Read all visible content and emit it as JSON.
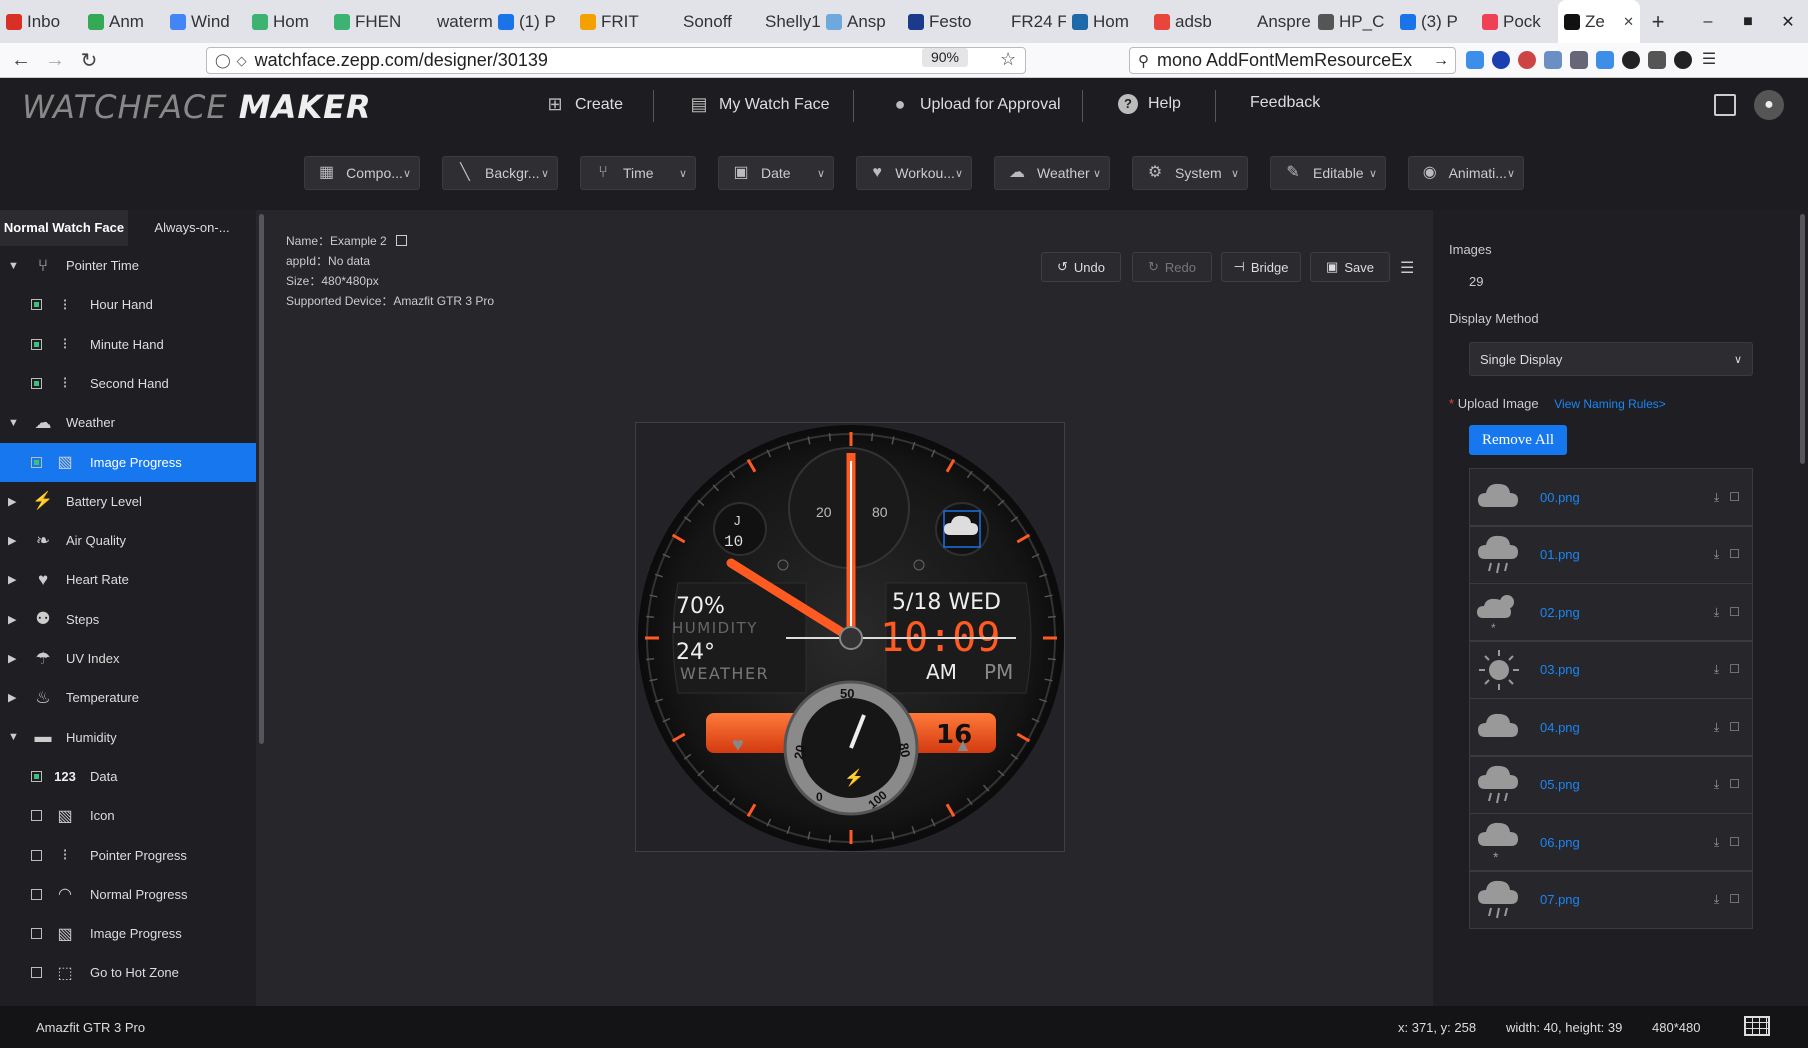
{
  "browser": {
    "tabs": [
      {
        "label": "Inbo",
        "color": "#d93025"
      },
      {
        "label": "Anm",
        "color": "#34a853"
      },
      {
        "label": "Wind",
        "color": "#4285f4"
      },
      {
        "label": "Hom",
        "color": "#3cb371"
      },
      {
        "label": "FHEN",
        "color": "#3cb371"
      },
      {
        "label": "waterm",
        "color": "#e1e3e8"
      },
      {
        "label": "(1) P",
        "color": "#1a73e8"
      },
      {
        "label": "FRIT",
        "color": "#f4a100"
      },
      {
        "label": "Sonoff",
        "color": "#e1e3e8"
      },
      {
        "label": "Shelly1",
        "color": "#e1e3e8"
      },
      {
        "label": "Ansp",
        "color": "#6fa8dc"
      },
      {
        "label": "Festo",
        "color": "#1a3a8a"
      },
      {
        "label": "FR24 F",
        "color": "#e1e3e8"
      },
      {
        "label": "Hom",
        "color": "#1e6aa8"
      },
      {
        "label": "adsb",
        "color": "#e8453c"
      },
      {
        "label": "Anspre",
        "color": "#e1e3e8"
      },
      {
        "label": "HP_C",
        "color": "#555555"
      },
      {
        "label": "(3) P",
        "color": "#1a73e8"
      },
      {
        "label": "Pock",
        "color": "#ef4056"
      },
      {
        "label": "Ze",
        "color": "#111111"
      }
    ],
    "new_tab": "+",
    "url": "watchface.zepp.com/designer/30139",
    "zoom": "90%",
    "search": "mono AddFontMemResourceEx"
  },
  "header": {
    "logo_light": "WATCHFACE",
    "logo_bold": "MAKER",
    "menu": [
      {
        "label": "Create",
        "icon": "plus-square-icon"
      },
      {
        "label": "My Watch Face",
        "icon": "folder-icon"
      },
      {
        "label": "Upload for Approval",
        "icon": "user-icon"
      },
      {
        "label": "Help",
        "icon": "help-icon"
      },
      {
        "label": "Feedback",
        "icon": ""
      }
    ],
    "components": [
      {
        "label": "Compo...",
        "icon": "grid-icon"
      },
      {
        "label": "Backgr...",
        "icon": "hatch-icon"
      },
      {
        "label": "Time",
        "icon": "hands-icon"
      },
      {
        "label": "Date",
        "icon": "calendar-icon"
      },
      {
        "label": "Workou...",
        "icon": "heart-icon"
      },
      {
        "label": "Weather",
        "icon": "cloud-sun-icon"
      },
      {
        "label": "System",
        "icon": "gear-icon"
      },
      {
        "label": "Editable",
        "icon": "edit-icon"
      },
      {
        "label": "Animati...",
        "icon": "animation-icon"
      }
    ]
  },
  "left": {
    "tabs": [
      "Normal Watch Face",
      "Always-on-..."
    ],
    "tree": [
      {
        "label": "Pointer Time",
        "type": "group",
        "expanded": true,
        "icon": "pointer-time-icon"
      },
      {
        "label": "Hour Hand",
        "type": "child",
        "checked": true,
        "icon": "hand-icon"
      },
      {
        "label": "Minute Hand",
        "type": "child",
        "checked": true,
        "icon": "hand-icon"
      },
      {
        "label": "Second Hand",
        "type": "child",
        "checked": true,
        "icon": "hand-icon"
      },
      {
        "label": "Weather",
        "type": "group",
        "expanded": true,
        "icon": "weather-icon"
      },
      {
        "label": "Image Progress",
        "type": "child",
        "checked": true,
        "icon": "image-icon",
        "selected": true
      },
      {
        "label": "Battery Level",
        "type": "group",
        "expanded": false,
        "icon": "bolt-icon"
      },
      {
        "label": "Air Quality",
        "type": "group",
        "expanded": false,
        "icon": "leaf-icon"
      },
      {
        "label": "Heart Rate",
        "type": "group",
        "expanded": false,
        "icon": "heart-icon"
      },
      {
        "label": "Steps",
        "type": "group",
        "expanded": false,
        "icon": "steps-icon"
      },
      {
        "label": "UV Index",
        "type": "group",
        "expanded": false,
        "icon": "umbrella-icon"
      },
      {
        "label": "Temperature",
        "type": "group",
        "expanded": false,
        "icon": "thermometer-icon"
      },
      {
        "label": "Humidity",
        "type": "group",
        "expanded": true,
        "icon": "folder-icon"
      },
      {
        "label": "Data",
        "type": "child",
        "checked": true,
        "icon": "number-icon"
      },
      {
        "label": "Icon",
        "type": "child",
        "checked": false,
        "icon": "image-icon"
      },
      {
        "label": "Pointer Progress",
        "type": "child",
        "checked": false,
        "icon": "hand-icon"
      },
      {
        "label": "Normal Progress",
        "type": "child",
        "checked": false,
        "icon": "arc-icon"
      },
      {
        "label": "Image Progress",
        "type": "child",
        "checked": false,
        "icon": "image-icon"
      },
      {
        "label": "Go to Hot Zone",
        "type": "child",
        "checked": false,
        "icon": "hotzone-icon"
      }
    ]
  },
  "canvas": {
    "name_label": "Name：",
    "name_value": "Example 2",
    "appid_label": "appId：",
    "appid_value": "No data",
    "size_label": "Size：",
    "size_value": "480*480px",
    "device_label": "Supported Device：",
    "device_value": "Amazfit GTR 3 Pro",
    "undo": "Undo",
    "redo": "Redo",
    "bridge": "Bridge",
    "save": "Save",
    "watch": {
      "humidity": "70%",
      "humidity_label": "HUMIDITY",
      "temp": "24°",
      "weather_label": "WEATHER",
      "date": "5/18 WED",
      "time": "10:09",
      "am": "AM",
      "pm": "PM",
      "day": "16",
      "uv_top": "J",
      "uv_value": "10",
      "dial_low": "20",
      "dial_high": "80",
      "gauge_top": "50",
      "gauge_left": "20",
      "gauge_right": "80",
      "gauge_bl": "0",
      "gauge_br": "100",
      "accent": "#ff5a22"
    }
  },
  "right": {
    "images_label": "Images",
    "images_count": "29",
    "display_label": "Display Method",
    "display_value": "Single Display",
    "upload_required": "*",
    "upload_label": "Upload Image",
    "naming_rules": "View Naming Rules>",
    "remove_all": "Remove All",
    "files": [
      {
        "name": "00.png",
        "icon": "cloud-icon"
      },
      {
        "name": "01.png",
        "icon": "cloud-rain-icon"
      },
      {
        "name": "02.png",
        "icon": "cloud-sun-snow-icon"
      },
      {
        "name": "03.png",
        "icon": "sun-icon"
      },
      {
        "name": "04.png",
        "icon": "cloud-icon"
      },
      {
        "name": "05.png",
        "icon": "cloud-rain-icon"
      },
      {
        "name": "06.png",
        "icon": "cloud-snow-icon"
      },
      {
        "name": "07.png",
        "icon": "cloud-rain-icon"
      }
    ]
  },
  "status": {
    "device": "Amazfit GTR 3 Pro",
    "coords": "x: 371, y: 258",
    "dims": "width: 40, height: 39",
    "resolution": "480*480"
  }
}
